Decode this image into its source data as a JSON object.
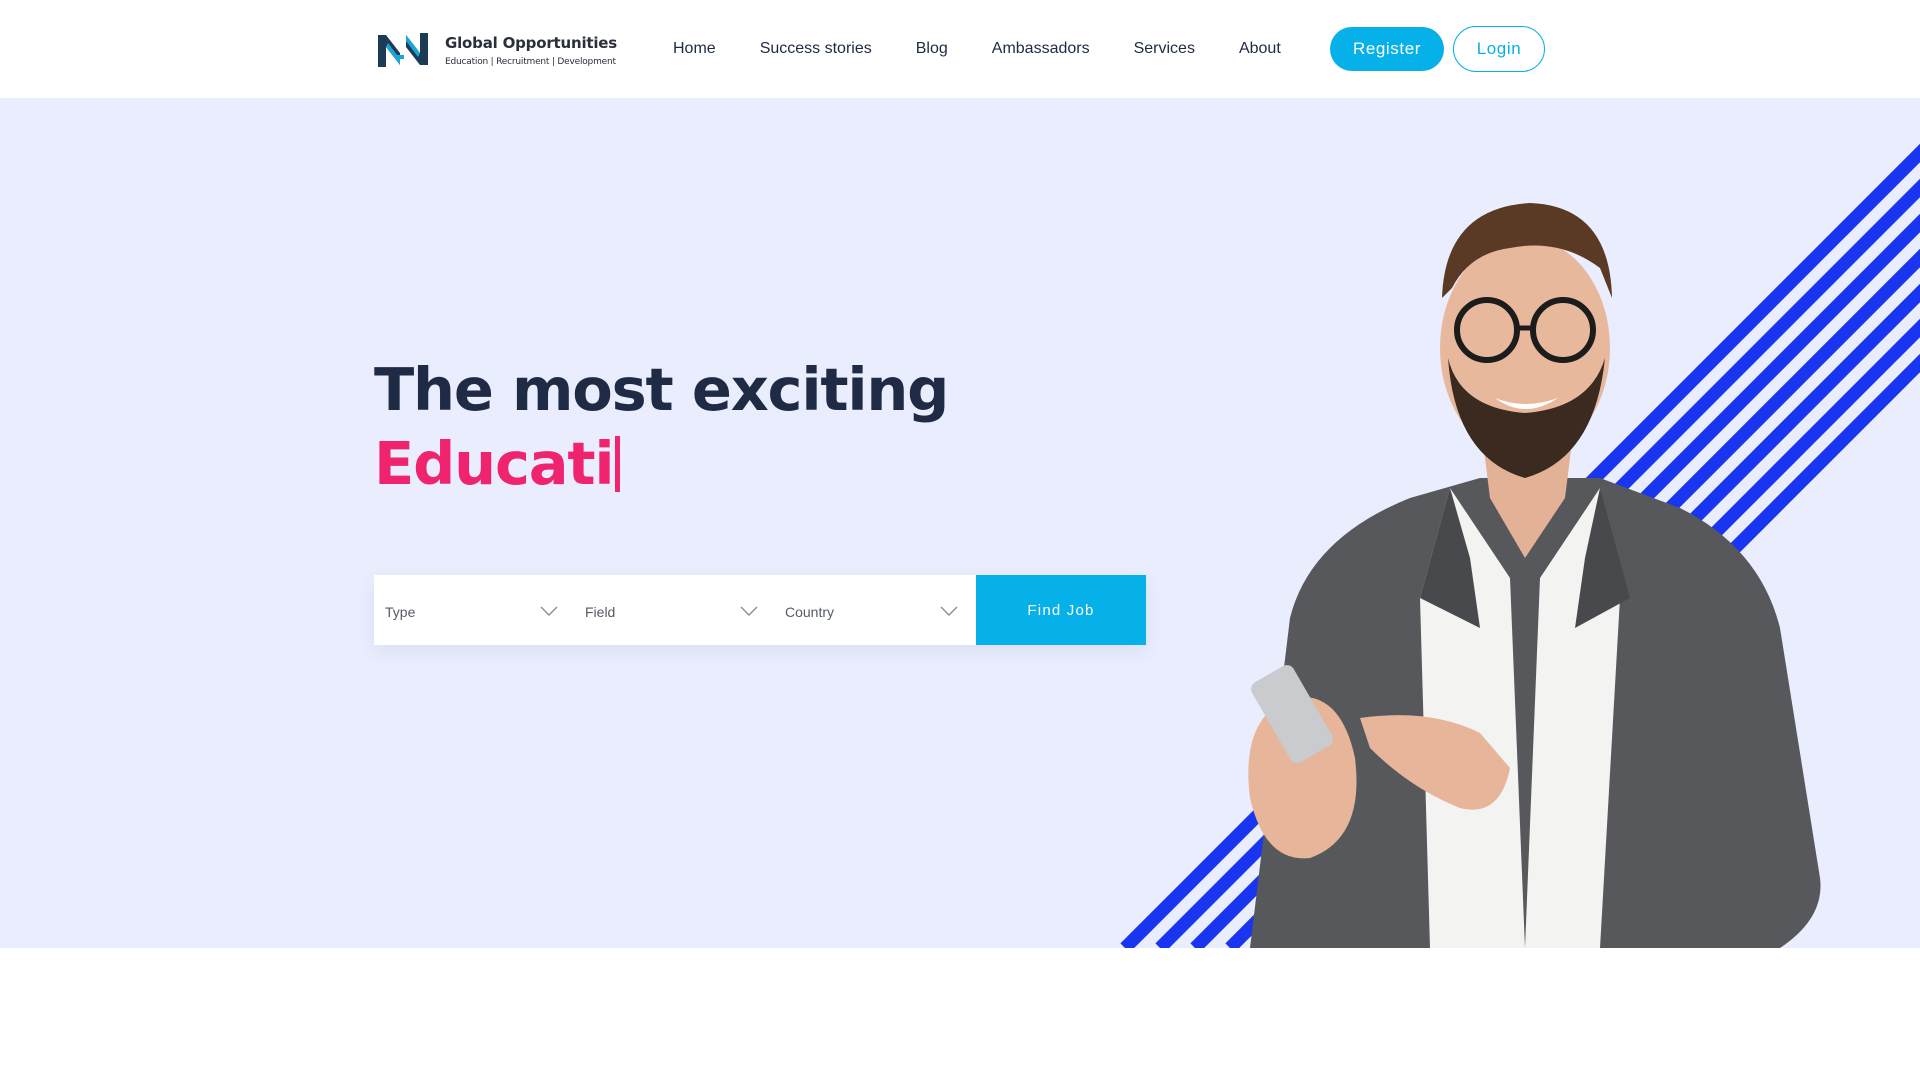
{
  "brand": {
    "name": "Global Opportunities",
    "tagline": "Education | Recruitment | Development",
    "logo_icon": "go-monogram-logo",
    "primary_color": "#06b0e8",
    "accent_color": "#f0246e",
    "dark_color": "#1f2a44"
  },
  "nav": {
    "items": [
      {
        "label": "Home"
      },
      {
        "label": "Success stories"
      },
      {
        "label": "Blog"
      },
      {
        "label": "Ambassadors"
      },
      {
        "label": "Services"
      },
      {
        "label": "About"
      }
    ],
    "register_label": "Register",
    "login_label": "Login"
  },
  "hero": {
    "headline_line1": "The most exciting",
    "headline_line2": "Educati",
    "background_color": "#e9edfd",
    "stripe_color": "#1a35f0",
    "image_subject": "smiling bearded man in glasses and grey blazer pointing at a smartphone"
  },
  "search": {
    "type_label": "Type",
    "field_label": "Field",
    "country_label": "Country",
    "button_label": "Find Job"
  }
}
